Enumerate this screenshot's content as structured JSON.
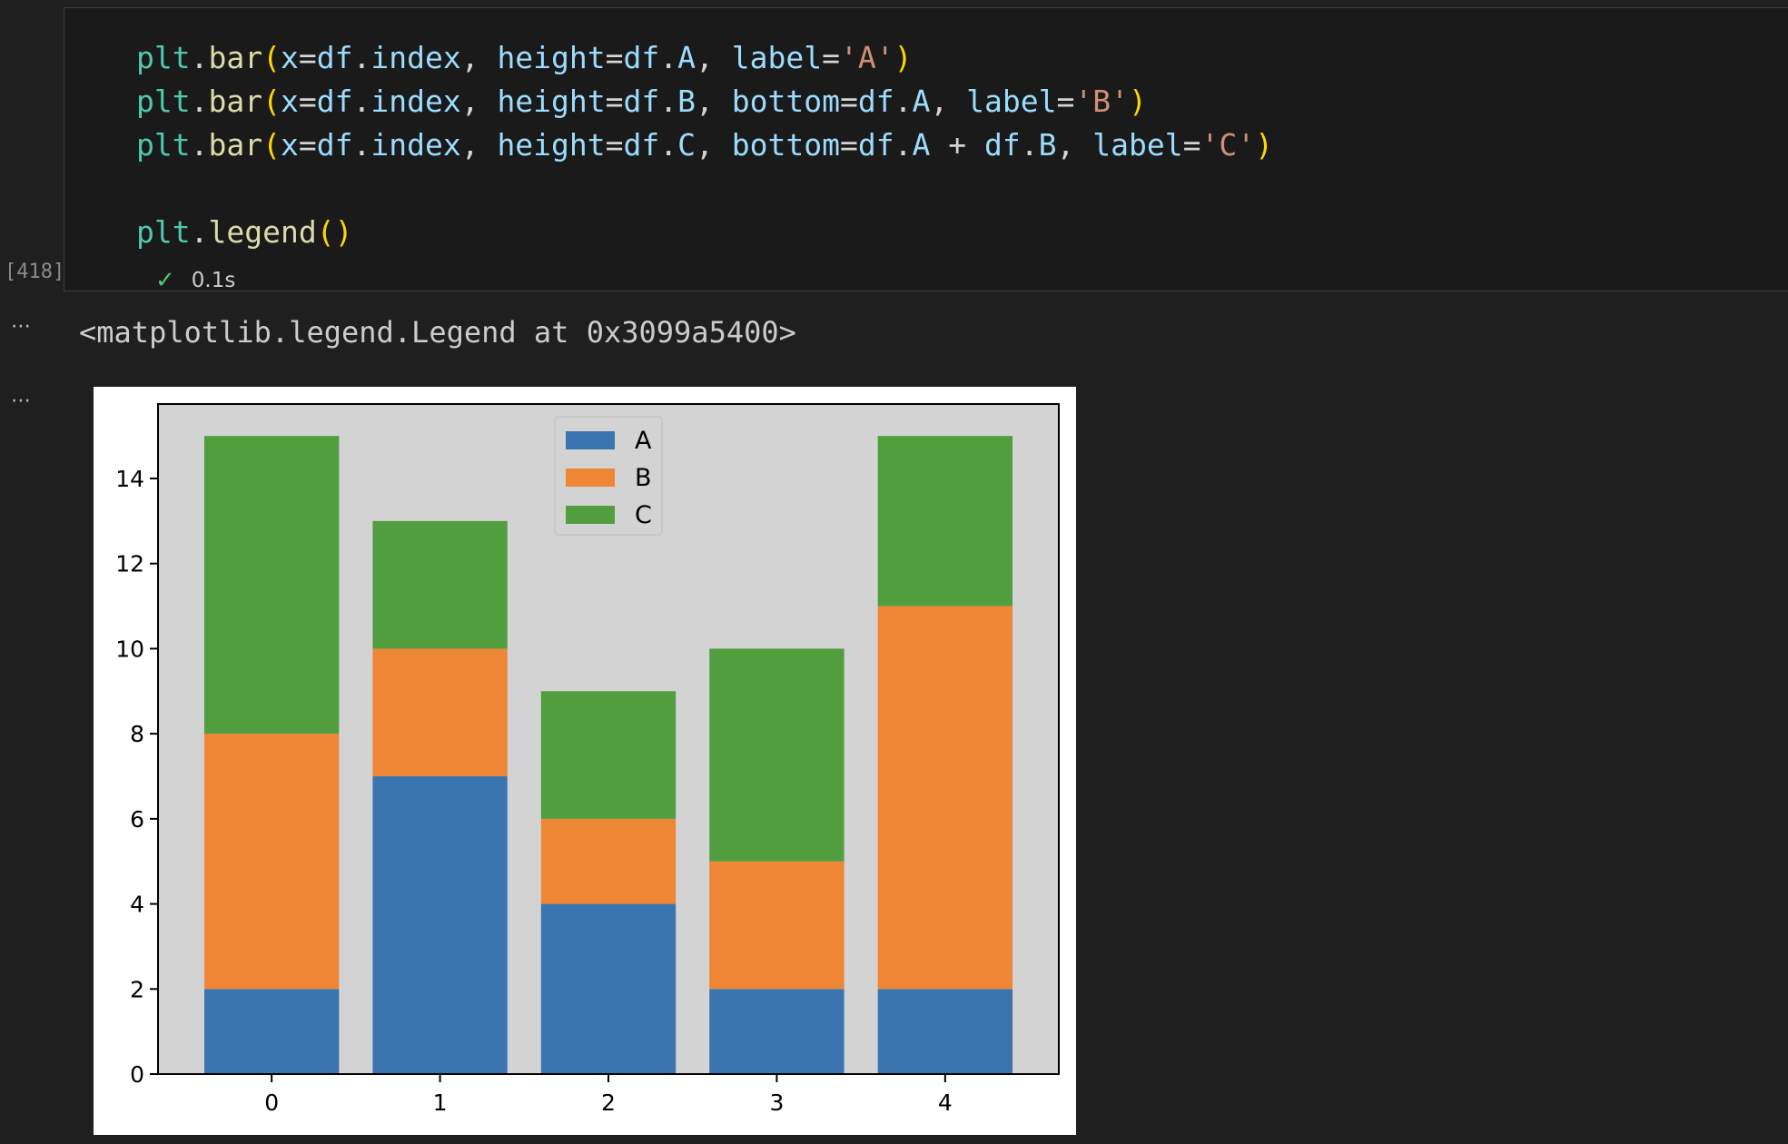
{
  "code_cell": {
    "lines": [
      [
        {
          "t": "plt",
          "c": "obj"
        },
        {
          "t": ".",
          "c": "punc"
        },
        {
          "t": "bar",
          "c": "fn"
        },
        {
          "t": "(",
          "c": "paren"
        },
        {
          "t": "x",
          "c": "param"
        },
        {
          "t": "=",
          "c": "op"
        },
        {
          "t": "df",
          "c": "param"
        },
        {
          "t": ".",
          "c": "punc"
        },
        {
          "t": "index",
          "c": "param"
        },
        {
          "t": ", ",
          "c": "punc"
        },
        {
          "t": "height",
          "c": "param"
        },
        {
          "t": "=",
          "c": "op"
        },
        {
          "t": "df",
          "c": "param"
        },
        {
          "t": ".",
          "c": "punc"
        },
        {
          "t": "A",
          "c": "param"
        },
        {
          "t": ", ",
          "c": "punc"
        },
        {
          "t": "label",
          "c": "param"
        },
        {
          "t": "=",
          "c": "op"
        },
        {
          "t": "'A'",
          "c": "str"
        },
        {
          "t": ")",
          "c": "paren"
        }
      ],
      [
        {
          "t": "plt",
          "c": "obj"
        },
        {
          "t": ".",
          "c": "punc"
        },
        {
          "t": "bar",
          "c": "fn"
        },
        {
          "t": "(",
          "c": "paren"
        },
        {
          "t": "x",
          "c": "param"
        },
        {
          "t": "=",
          "c": "op"
        },
        {
          "t": "df",
          "c": "param"
        },
        {
          "t": ".",
          "c": "punc"
        },
        {
          "t": "index",
          "c": "param"
        },
        {
          "t": ", ",
          "c": "punc"
        },
        {
          "t": "height",
          "c": "param"
        },
        {
          "t": "=",
          "c": "op"
        },
        {
          "t": "df",
          "c": "param"
        },
        {
          "t": ".",
          "c": "punc"
        },
        {
          "t": "B",
          "c": "param"
        },
        {
          "t": ", ",
          "c": "punc"
        },
        {
          "t": "bottom",
          "c": "param"
        },
        {
          "t": "=",
          "c": "op"
        },
        {
          "t": "df",
          "c": "param"
        },
        {
          "t": ".",
          "c": "punc"
        },
        {
          "t": "A",
          "c": "param"
        },
        {
          "t": ", ",
          "c": "punc"
        },
        {
          "t": "label",
          "c": "param"
        },
        {
          "t": "=",
          "c": "op"
        },
        {
          "t": "'B'",
          "c": "str"
        },
        {
          "t": ")",
          "c": "paren"
        }
      ],
      [
        {
          "t": "plt",
          "c": "obj"
        },
        {
          "t": ".",
          "c": "punc"
        },
        {
          "t": "bar",
          "c": "fn"
        },
        {
          "t": "(",
          "c": "paren"
        },
        {
          "t": "x",
          "c": "param"
        },
        {
          "t": "=",
          "c": "op"
        },
        {
          "t": "df",
          "c": "param"
        },
        {
          "t": ".",
          "c": "punc"
        },
        {
          "t": "index",
          "c": "param"
        },
        {
          "t": ", ",
          "c": "punc"
        },
        {
          "t": "height",
          "c": "param"
        },
        {
          "t": "=",
          "c": "op"
        },
        {
          "t": "df",
          "c": "param"
        },
        {
          "t": ".",
          "c": "punc"
        },
        {
          "t": "C",
          "c": "param"
        },
        {
          "t": ", ",
          "c": "punc"
        },
        {
          "t": "bottom",
          "c": "param"
        },
        {
          "t": "=",
          "c": "op"
        },
        {
          "t": "df",
          "c": "param"
        },
        {
          "t": ".",
          "c": "punc"
        },
        {
          "t": "A",
          "c": "param"
        },
        {
          "t": " + ",
          "c": "op"
        },
        {
          "t": "df",
          "c": "param"
        },
        {
          "t": ".",
          "c": "punc"
        },
        {
          "t": "B",
          "c": "param"
        },
        {
          "t": ", ",
          "c": "punc"
        },
        {
          "t": "label",
          "c": "param"
        },
        {
          "t": "=",
          "c": "op"
        },
        {
          "t": "'C'",
          "c": "str"
        },
        {
          "t": ")",
          "c": "paren"
        }
      ],
      [],
      [
        {
          "t": "plt",
          "c": "obj"
        },
        {
          "t": ".",
          "c": "punc"
        },
        {
          "t": "legend",
          "c": "fn"
        },
        {
          "t": "()",
          "c": "paren"
        }
      ]
    ],
    "execution_count": "[418]",
    "status_icon": "check-icon",
    "duration": "0.1s"
  },
  "outputs": {
    "more_icon": "⋯",
    "text_output": "<matplotlib.legend.Legend at 0x3099a5400>"
  },
  "colors": {
    "A": "#3a75b0",
    "B": "#ef8636",
    "C": "#519e3e",
    "axes_bg": "#d3d3d3"
  },
  "chart_data": {
    "type": "bar",
    "stacked": true,
    "categories": [
      "0",
      "1",
      "2",
      "3",
      "4"
    ],
    "series": [
      {
        "name": "A",
        "values": [
          2,
          7,
          4,
          2,
          2
        ]
      },
      {
        "name": "B",
        "values": [
          6,
          3,
          2,
          3,
          9
        ]
      },
      {
        "name": "C",
        "values": [
          7,
          3,
          3,
          5,
          4
        ]
      }
    ],
    "ylim": [
      0,
      15.75
    ],
    "yticks": [
      "0",
      "2",
      "4",
      "6",
      "8",
      "10",
      "12",
      "14"
    ],
    "grid": false,
    "legend_placement": "upper center"
  }
}
